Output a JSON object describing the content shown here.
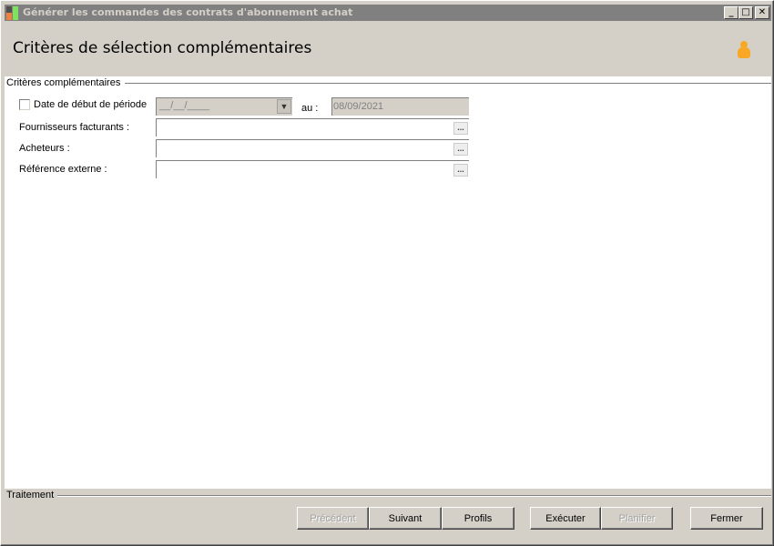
{
  "window": {
    "title": "Générer les commandes des contrats d'abonnement achat",
    "minimize": "_",
    "maximize": "□",
    "close": "✕"
  },
  "header": {
    "title": "Critères de sélection complémentaires",
    "icon": "user-icon"
  },
  "criteria": {
    "group_label": "Critères complémentaires",
    "start_date_label": "Date de début de période",
    "start_date_value": "__/__/____",
    "to_label": "au :",
    "end_date_value": "08/09/2021",
    "suppliers_label": "Fournisseurs facturants :",
    "buyers_label": "Acheteurs :",
    "external_ref_label": "Référence externe :",
    "ellipsis": "..."
  },
  "footer": {
    "group_label": "Traitement",
    "buttons": {
      "previous": "Précédent",
      "next": "Suivant",
      "profiles": "Profils",
      "execute": "Exécuter",
      "schedule": "Planifier",
      "close": "Fermer"
    }
  }
}
